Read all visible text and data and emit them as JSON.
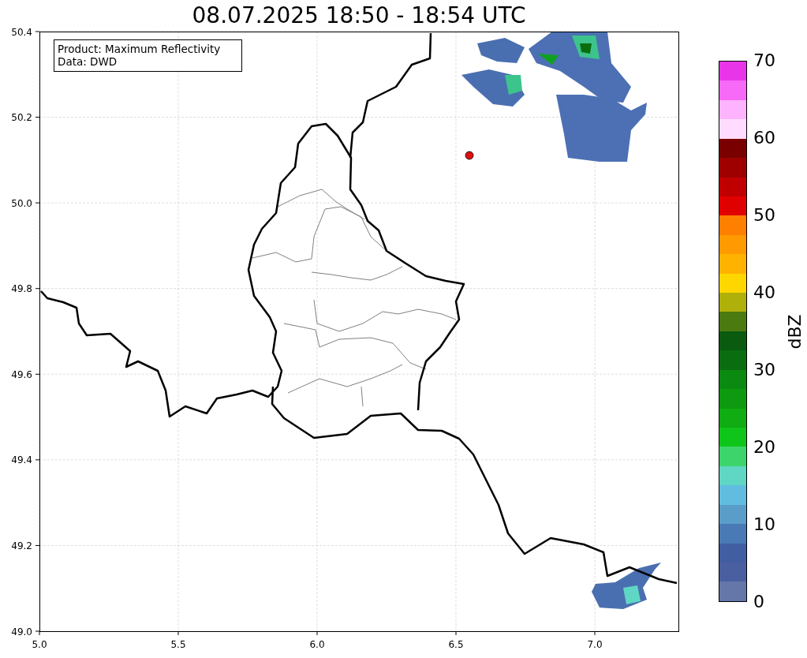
{
  "title": "08.07.2025 18:50 - 18:54 UTC",
  "info_box": {
    "lines": [
      "Product: Maximum Reflectivity",
      "Data: DWD"
    ]
  },
  "map": {
    "xticks": [
      "5.0",
      "5.5",
      "6.0",
      "6.5",
      "7.0"
    ],
    "yticks": [
      "50.4",
      "50.2",
      "50.0",
      "49.8",
      "49.6",
      "49.4",
      "49.2",
      "49.0"
    ]
  },
  "colorbar": {
    "label": "dBZ",
    "ticks": [
      "70",
      "60",
      "50",
      "40",
      "30",
      "20",
      "10",
      "0"
    ],
    "segments": [
      {
        "color": "#e935e9"
      },
      {
        "color": "#f76af7"
      },
      {
        "color": "#fdb3fd"
      },
      {
        "color": "#ffdcff"
      },
      {
        "color": "#7a0000"
      },
      {
        "color": "#9e0000"
      },
      {
        "color": "#c00000"
      },
      {
        "color": "#e00000"
      },
      {
        "color": "#ff7f00"
      },
      {
        "color": "#ff9a00"
      },
      {
        "color": "#ffb300"
      },
      {
        "color": "#ffd700"
      },
      {
        "color": "#b0b00a"
      },
      {
        "color": "#4a7a10"
      },
      {
        "color": "#0a5a10"
      },
      {
        "color": "#0a6e10"
      },
      {
        "color": "#0a8a10"
      },
      {
        "color": "#0d9a10"
      },
      {
        "color": "#0fac12"
      },
      {
        "color": "#10c51a"
      },
      {
        "color": "#3dd46c"
      },
      {
        "color": "#60d6c4"
      },
      {
        "color": "#60bde0"
      },
      {
        "color": "#5b9dc9"
      },
      {
        "color": "#4a7ab5"
      },
      {
        "color": "#415ea3"
      },
      {
        "color": "#4a5fa0"
      },
      {
        "color": "#6577a8"
      }
    ]
  }
}
